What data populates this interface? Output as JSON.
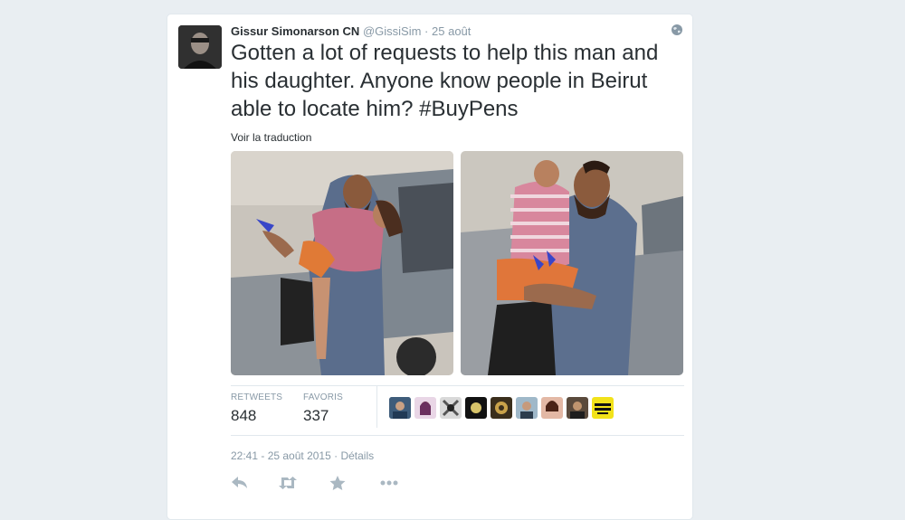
{
  "tweet": {
    "author_name": "Gissur Simonarson CN",
    "handle": "@GissiSim",
    "separator": "·",
    "time": "25 août",
    "text": "Gotten a lot of requests to help this man and his daughter. Anyone know people in Beirut able to locate him? ",
    "hashtag": "#BuyPens",
    "translate_label": "Voir la traduction",
    "stats": {
      "retweets_label": "RETWEETS",
      "retweets_value": "848",
      "favorites_label": "FAVORIS",
      "favorites_value": "337"
    },
    "datetime": "22:41 - 25 août 2015",
    "details_separator": "·",
    "details_label": "Détails"
  },
  "icons": {
    "globe": "globe-icon",
    "reply": "reply-icon",
    "retweet": "retweet-icon",
    "favorite": "star-icon",
    "more": "more-icon"
  },
  "colors": {
    "background": "#e9eef2",
    "card": "#ffffff",
    "muted_text": "#8899a6",
    "action_icon": "#aab8c2",
    "border": "#e1e8ed"
  }
}
